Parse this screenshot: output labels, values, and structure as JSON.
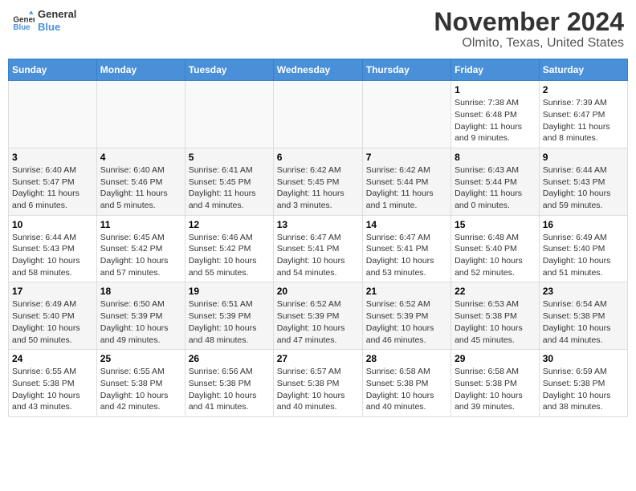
{
  "header": {
    "logo": {
      "line1": "General",
      "line2": "Blue"
    },
    "title": "November 2024",
    "subtitle": "Olmito, Texas, United States"
  },
  "calendar": {
    "headers": [
      "Sunday",
      "Monday",
      "Tuesday",
      "Wednesday",
      "Thursday",
      "Friday",
      "Saturday"
    ],
    "weeks": [
      [
        {
          "day": "",
          "info": ""
        },
        {
          "day": "",
          "info": ""
        },
        {
          "day": "",
          "info": ""
        },
        {
          "day": "",
          "info": ""
        },
        {
          "day": "",
          "info": ""
        },
        {
          "day": "1",
          "info": "Sunrise: 7:38 AM\nSunset: 6:48 PM\nDaylight: 11 hours and 9 minutes."
        },
        {
          "day": "2",
          "info": "Sunrise: 7:39 AM\nSunset: 6:47 PM\nDaylight: 11 hours and 8 minutes."
        }
      ],
      [
        {
          "day": "3",
          "info": "Sunrise: 6:40 AM\nSunset: 5:47 PM\nDaylight: 11 hours and 6 minutes."
        },
        {
          "day": "4",
          "info": "Sunrise: 6:40 AM\nSunset: 5:46 PM\nDaylight: 11 hours and 5 minutes."
        },
        {
          "day": "5",
          "info": "Sunrise: 6:41 AM\nSunset: 5:45 PM\nDaylight: 11 hours and 4 minutes."
        },
        {
          "day": "6",
          "info": "Sunrise: 6:42 AM\nSunset: 5:45 PM\nDaylight: 11 hours and 3 minutes."
        },
        {
          "day": "7",
          "info": "Sunrise: 6:42 AM\nSunset: 5:44 PM\nDaylight: 11 hours and 1 minute."
        },
        {
          "day": "8",
          "info": "Sunrise: 6:43 AM\nSunset: 5:44 PM\nDaylight: 11 hours and 0 minutes."
        },
        {
          "day": "9",
          "info": "Sunrise: 6:44 AM\nSunset: 5:43 PM\nDaylight: 10 hours and 59 minutes."
        }
      ],
      [
        {
          "day": "10",
          "info": "Sunrise: 6:44 AM\nSunset: 5:43 PM\nDaylight: 10 hours and 58 minutes."
        },
        {
          "day": "11",
          "info": "Sunrise: 6:45 AM\nSunset: 5:42 PM\nDaylight: 10 hours and 57 minutes."
        },
        {
          "day": "12",
          "info": "Sunrise: 6:46 AM\nSunset: 5:42 PM\nDaylight: 10 hours and 55 minutes."
        },
        {
          "day": "13",
          "info": "Sunrise: 6:47 AM\nSunset: 5:41 PM\nDaylight: 10 hours and 54 minutes."
        },
        {
          "day": "14",
          "info": "Sunrise: 6:47 AM\nSunset: 5:41 PM\nDaylight: 10 hours and 53 minutes."
        },
        {
          "day": "15",
          "info": "Sunrise: 6:48 AM\nSunset: 5:40 PM\nDaylight: 10 hours and 52 minutes."
        },
        {
          "day": "16",
          "info": "Sunrise: 6:49 AM\nSunset: 5:40 PM\nDaylight: 10 hours and 51 minutes."
        }
      ],
      [
        {
          "day": "17",
          "info": "Sunrise: 6:49 AM\nSunset: 5:40 PM\nDaylight: 10 hours and 50 minutes."
        },
        {
          "day": "18",
          "info": "Sunrise: 6:50 AM\nSunset: 5:39 PM\nDaylight: 10 hours and 49 minutes."
        },
        {
          "day": "19",
          "info": "Sunrise: 6:51 AM\nSunset: 5:39 PM\nDaylight: 10 hours and 48 minutes."
        },
        {
          "day": "20",
          "info": "Sunrise: 6:52 AM\nSunset: 5:39 PM\nDaylight: 10 hours and 47 minutes."
        },
        {
          "day": "21",
          "info": "Sunrise: 6:52 AM\nSunset: 5:39 PM\nDaylight: 10 hours and 46 minutes."
        },
        {
          "day": "22",
          "info": "Sunrise: 6:53 AM\nSunset: 5:38 PM\nDaylight: 10 hours and 45 minutes."
        },
        {
          "day": "23",
          "info": "Sunrise: 6:54 AM\nSunset: 5:38 PM\nDaylight: 10 hours and 44 minutes."
        }
      ],
      [
        {
          "day": "24",
          "info": "Sunrise: 6:55 AM\nSunset: 5:38 PM\nDaylight: 10 hours and 43 minutes."
        },
        {
          "day": "25",
          "info": "Sunrise: 6:55 AM\nSunset: 5:38 PM\nDaylight: 10 hours and 42 minutes."
        },
        {
          "day": "26",
          "info": "Sunrise: 6:56 AM\nSunset: 5:38 PM\nDaylight: 10 hours and 41 minutes."
        },
        {
          "day": "27",
          "info": "Sunrise: 6:57 AM\nSunset: 5:38 PM\nDaylight: 10 hours and 40 minutes."
        },
        {
          "day": "28",
          "info": "Sunrise: 6:58 AM\nSunset: 5:38 PM\nDaylight: 10 hours and 40 minutes."
        },
        {
          "day": "29",
          "info": "Sunrise: 6:58 AM\nSunset: 5:38 PM\nDaylight: 10 hours and 39 minutes."
        },
        {
          "day": "30",
          "info": "Sunrise: 6:59 AM\nSunset: 5:38 PM\nDaylight: 10 hours and 38 minutes."
        }
      ]
    ]
  }
}
